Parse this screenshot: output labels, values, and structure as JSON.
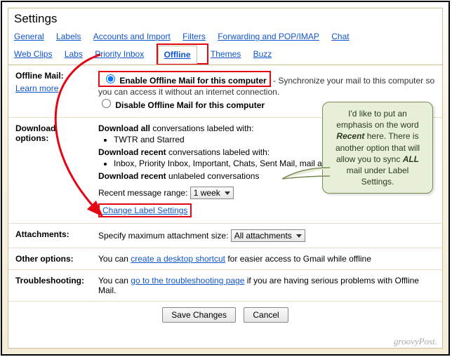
{
  "title": "Settings",
  "tabs": {
    "row1": [
      "General",
      "Labels",
      "Accounts and Import",
      "Filters",
      "Forwarding and POP/IMAP",
      "Chat"
    ],
    "row2_before": [
      "Web Clips",
      "Labs",
      "Priority Inbox"
    ],
    "active": "Offline",
    "row2_after": [
      "Themes",
      "Buzz"
    ]
  },
  "offline": {
    "label": "Offline Mail:",
    "learn": "Learn more",
    "enable_label": "Enable Offline Mail for this computer",
    "enable_desc": " - Synchronize your mail to this computer so you can access it without an internet connection.",
    "disable_label": "Disable Offline Mail for this computer"
  },
  "download": {
    "label": "Download options:",
    "all_prefix": "Download all",
    "all_rest": " conversations labeled with:",
    "all_items": [
      "TWTR and Starred"
    ],
    "recent_prefix": "Download recent",
    "recent_rest": " conversations labeled with:",
    "recent_items": [
      "Inbox, Priority Inbox, Important, Chats, Sent Mail, mail and SU.PR"
    ],
    "recent_unlabeled_prefix": "Download recent",
    "recent_unlabeled_rest": " unlabeled conversations",
    "range_label": "Recent message range:",
    "range_value": "1 week",
    "change_label": "Change Label Settings"
  },
  "attachments": {
    "label": "Attachments:",
    "text": "Specify maximum attachment size:",
    "value": "All attachments"
  },
  "other": {
    "label": "Other options:",
    "before": "You can ",
    "link": "create a desktop shortcut",
    "after": " for easier access to Gmail while offline"
  },
  "troubleshoot": {
    "label": "Troubleshooting:",
    "before": "You can ",
    "link": "go to the troubleshooting page",
    "after": " if you are having serious problems with Offline Mail."
  },
  "buttons": {
    "save": "Save Changes",
    "cancel": "Cancel"
  },
  "callout": {
    "line1": "I'd like to put an emphasis on the word ",
    "word": "Recent",
    "line2": " here. There is another option that will allow you to sync ",
    "all": "ALL",
    "line3": " mail under Label Settings."
  },
  "watermark": "groovyPost."
}
